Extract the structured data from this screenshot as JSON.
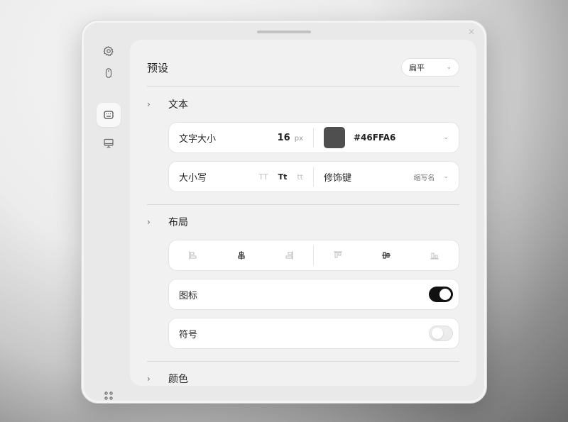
{
  "icons": {
    "sidebar": [
      "gear-icon",
      "mouse-icon",
      "keyboard-icon",
      "monitor-icon",
      "apps-grid-icon"
    ],
    "close": "close-icon"
  },
  "colors": {
    "accent_text": "#46FFA6",
    "swatch": "#4f4f4f",
    "toggle_on": "#111111"
  },
  "preset": {
    "title": "预设",
    "value": "扁平"
  },
  "text_section": {
    "title": "文本",
    "font_size_label": "文字大小",
    "font_size_value": "16",
    "font_size_unit": "px",
    "color_value": "#46FFA6",
    "case_label": "大小写",
    "case_options": [
      "TT",
      "Tt",
      "tt"
    ],
    "case_selected": "Tt",
    "modifier_label": "修饰键",
    "modifier_value": "缩写名"
  },
  "layout_section": {
    "title": "布局",
    "icon_label": "图标",
    "icon_enabled": true,
    "symbol_label": "符号",
    "symbol_enabled": false
  },
  "color_section": {
    "title": "颜色"
  }
}
